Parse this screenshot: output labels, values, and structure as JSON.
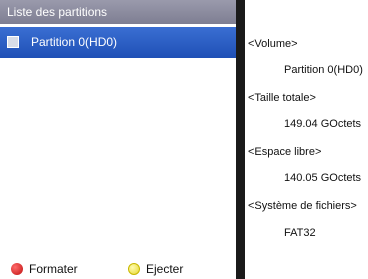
{
  "partition_list": {
    "title": "Liste des partitions",
    "items": [
      {
        "label": "Partition 0(HD0)",
        "selected": true
      }
    ]
  },
  "details": {
    "volume_label": "<Volume>",
    "volume_value": "Partition 0(HD0)",
    "total_size_label": "<Taille totale>",
    "total_size_value": "149.04 GOctets",
    "free_space_label": "<Espace libre>",
    "free_space_value": "140.05 GOctets",
    "filesystem_label": "<Système de fichiers>",
    "filesystem_value": "FAT32"
  },
  "footer": {
    "format_label": "Formater",
    "format_color": "#d01818",
    "eject_label": "Ejecter",
    "eject_color": "#f2e64a"
  },
  "colors": {
    "title_bar": "#8a8a9e",
    "selection": "#2a5cc4",
    "divider": "#1a1a1a"
  }
}
